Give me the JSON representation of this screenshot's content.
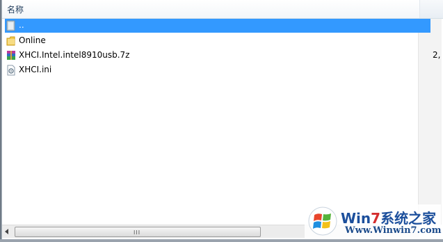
{
  "header": {
    "name_label": "名称"
  },
  "rows": [
    {
      "label": "..",
      "icon": "folder-up-icon",
      "selected": true
    },
    {
      "label": "Online",
      "icon": "folder-icon",
      "selected": false
    },
    {
      "label": "XHCI.Intel.intel8910usb.7z",
      "icon": "archive-icon",
      "selected": false,
      "size": "2,"
    },
    {
      "label": "XHCI.ini",
      "icon": "config-file-icon",
      "selected": false
    }
  ],
  "scrollbar": {
    "grip": "III"
  },
  "watermark": {
    "title_prefix": "Win",
    "title_num": "7",
    "title_suffix": "系统之家",
    "url": "Www.Winwin7.com"
  },
  "colors": {
    "selection": "#3399ff",
    "header_text": "#1e3a5a",
    "watermark_blue": "#1c4f9c"
  }
}
